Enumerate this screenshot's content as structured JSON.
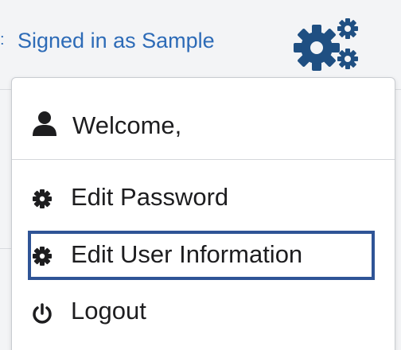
{
  "header": {
    "signed_in_text": "Signed in as Sample",
    "left_fragment": ":",
    "settings_icon": "gears-icon"
  },
  "menu": {
    "welcome_text": "Welcome,",
    "welcome_icon": "user-icon",
    "items": [
      {
        "label": "Edit Password",
        "icon": "gear-icon"
      },
      {
        "label": "Edit User Information",
        "icon": "gear-icon",
        "highlighted": true
      },
      {
        "label": "Logout",
        "icon": "power-icon"
      }
    ]
  },
  "colors": {
    "link": "#2d6bb7",
    "gears": "#1f4f82",
    "highlight_border": "#2f5496",
    "text": "#1d1d1f"
  }
}
